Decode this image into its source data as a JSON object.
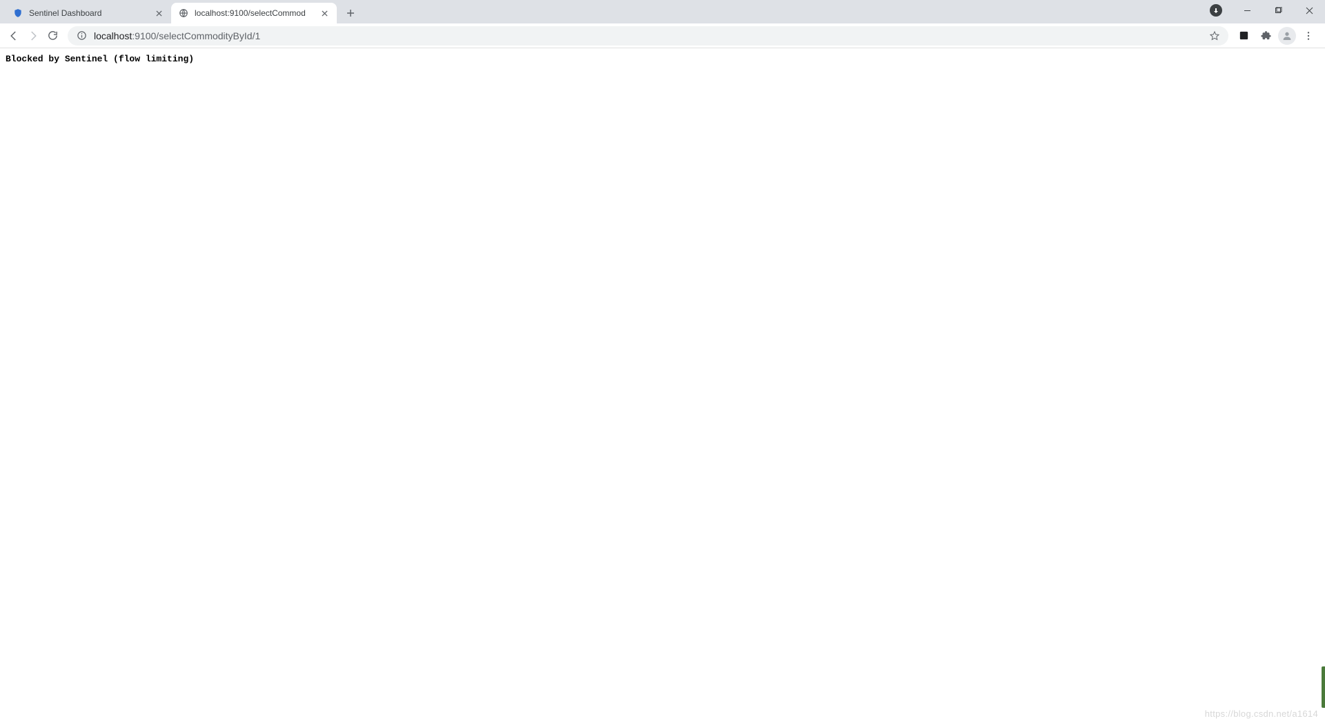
{
  "tabs": [
    {
      "title": "Sentinel Dashboard",
      "active": false
    },
    {
      "title": "localhost:9100/selectCommod",
      "active": true
    }
  ],
  "address": {
    "host": "localhost",
    "port_path": ":9100/selectCommodityById/1"
  },
  "page": {
    "body_text": "Blocked by Sentinel (flow limiting)"
  },
  "watermark": "https://blog.csdn.net/a1614"
}
